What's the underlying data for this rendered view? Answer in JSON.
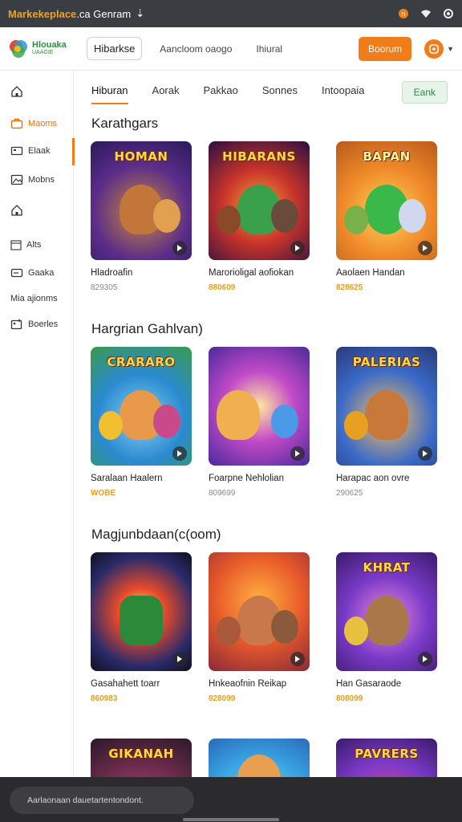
{
  "status_bar": {
    "title_bold": "Markekeplace",
    "title_rest": ".ca Genram",
    "icons": [
      "upload-arrow-icon",
      "notification-icon",
      "wifi-icon",
      "settings-icon"
    ]
  },
  "header": {
    "logo_line1": "Hlouaka",
    "logo_line2": "UAAGIE",
    "nav_pill": "Hibarkse",
    "nav_links": [
      "Aancloom oaogo",
      "Ihiural"
    ],
    "cta_label": "Boorum",
    "accent_color": "#f07d1a"
  },
  "sidebar": {
    "items": [
      {
        "label": "",
        "icon": "home-icon"
      },
      {
        "label": "Maoms",
        "icon": "briefcase-icon",
        "active": true
      },
      {
        "label": "Elaak",
        "icon": "folder-icon"
      },
      {
        "label": "Mobns",
        "icon": "image-icon"
      },
      {
        "label": "",
        "icon": "home-icon"
      },
      {
        "label": "Alts",
        "icon": "calendar-icon"
      },
      {
        "label": "Gaaka",
        "icon": "card-icon"
      },
      {
        "label": "Mia ajionms",
        "icon": ""
      },
      {
        "label": "Boerles",
        "icon": "gallery-icon"
      }
    ]
  },
  "tabs": {
    "items": [
      "Hiburan",
      "Aorak",
      "Pakkao",
      "Sonnes",
      "Intoopaia"
    ],
    "button": "Eank"
  },
  "sections": [
    {
      "title": "Karathgars",
      "cards": [
        {
          "thumb_text": "HOMAN",
          "name": "Hladroafin",
          "price": "829305",
          "accent": false
        },
        {
          "thumb_text": "HIBARANS",
          "name": "Marorioligal aofiokan",
          "price": "880609",
          "accent": true
        },
        {
          "thumb_text": "BAPAN",
          "name": "Aaolaen Handan",
          "price": "828625",
          "accent": true
        }
      ]
    },
    {
      "title": "Hargrian Gahlvan)",
      "cards": [
        {
          "thumb_text": "CRARARO",
          "name": "Saralaan Haalern",
          "price": "WOBE",
          "accent": true
        },
        {
          "thumb_text": "",
          "name": "Foarpne Nehlolian",
          "price": "809699",
          "accent": false
        },
        {
          "thumb_text": "PALERIAS",
          "name": "Harapac aon ovre",
          "price": "290625",
          "accent": false
        }
      ]
    },
    {
      "title": "Magjunbdaan(c(oom)",
      "cards": [
        {
          "thumb_text": "",
          "name": "Gasahahett toarr",
          "price": "860983",
          "accent": true
        },
        {
          "thumb_text": "",
          "name": "Hnkeaofnin Reikap",
          "price": "828099",
          "accent": true
        },
        {
          "thumb_text": "KHRAT",
          "name": "Han Gasaraode",
          "price": "808099",
          "accent": true
        }
      ]
    },
    {
      "title": "",
      "cards": [
        {
          "thumb_text": "GIKANAH",
          "name": "",
          "price": "",
          "accent": false
        },
        {
          "thumb_text": "",
          "name": "",
          "price": "",
          "accent": false
        },
        {
          "thumb_text": "PAVRERS",
          "name": "",
          "price": "",
          "accent": false
        }
      ]
    }
  ],
  "toast": {
    "text": "Aarlaonaan dauetartentondont."
  }
}
